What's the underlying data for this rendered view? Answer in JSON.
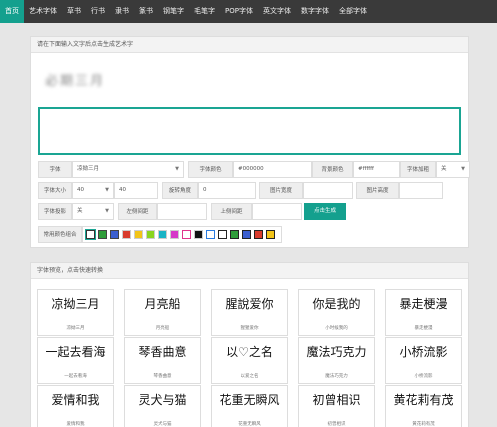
{
  "nav": {
    "items": [
      "首页",
      "艺术字体",
      "草书",
      "行书",
      "隶书",
      "篆书",
      "钢笔字",
      "毛笔字",
      "POP字体",
      "英文字体",
      "数字字体",
      "全部字体"
    ],
    "active_index": 0
  },
  "form_panel": {
    "title": "请在下面输入文字后点击生成艺术字",
    "preview_text": "必期三月",
    "textarea_placeholder": "",
    "font_label": "字体",
    "font_value": "凉拗三月",
    "font_color_label": "字体颜色",
    "font_color_value": "#000000",
    "bg_color_label": "背景颜色",
    "bg_color_value": "#ffffff",
    "bold_label": "字体加粗",
    "bold_value": "关",
    "size_label": "字体大小",
    "size_select_value": "40",
    "size_input_value": "40",
    "rotate_label": "旋转角度",
    "rotate_value": "0",
    "img_width_label": "图片宽度",
    "img_width_value": "",
    "img_height_label": "图片高度",
    "img_height_value": "",
    "shadow_label": "字体投影",
    "shadow_value": "关",
    "left_gap_label": "左侧间距",
    "left_gap_value": "",
    "top_gap_label": "上侧间距",
    "top_gap_value": "",
    "generate_label": "点击生成",
    "palette_label": "常用颜色组合",
    "palette": [
      {
        "fill": "#ffffff",
        "border": "#333333"
      },
      {
        "fill": "#2e9c3a",
        "border": "#444444"
      },
      {
        "fill": "#3b5fd0",
        "border": "#444444"
      },
      {
        "fill": "#d83b2d",
        "border": "#ffffff"
      },
      {
        "fill": "#f2c418",
        "border": "#ffffff"
      },
      {
        "fill": "#8ad41e",
        "border": "#ffffff"
      },
      {
        "fill": "#19b3c5",
        "border": "#ffffff"
      },
      {
        "fill": "#d638c8",
        "border": "#ffffff"
      },
      {
        "fill": "#ffffff",
        "border": "#e0338a"
      },
      {
        "fill": "#111111",
        "border": "#ffffff"
      },
      {
        "fill": "#ffffff",
        "border": "#2a7be0"
      },
      {
        "fill": "#ffffff",
        "border": "#222222"
      },
      {
        "fill": "#2e9c3a",
        "border": "#222222"
      },
      {
        "fill": "#3b5fd0",
        "border": "#222222"
      },
      {
        "fill": "#d83b2d",
        "border": "#222222"
      },
      {
        "fill": "#f2c418",
        "border": "#222222"
      }
    ]
  },
  "preview_panel": {
    "title": "字体预览，点击快速转换",
    "cards": [
      {
        "art": "凉拗三月",
        "name": "凉拗三月"
      },
      {
        "art": "月亮船",
        "name": "月亮船"
      },
      {
        "art": "腥說爱你",
        "name": "猩猩爱你"
      },
      {
        "art": "你是我的",
        "name": "小时候我的"
      },
      {
        "art": "暴走梗漫",
        "name": "暴走梗漫"
      },
      {
        "art": "一起去看海",
        "name": "一起去看海"
      },
      {
        "art": "琴香曲意",
        "name": "琴香曲意"
      },
      {
        "art": "以♡之名",
        "name": "以爱之名"
      },
      {
        "art": "魔法巧克力",
        "name": "魔法巧克力"
      },
      {
        "art": "小桥流影",
        "name": "小桥流影"
      },
      {
        "art": "爱情和我",
        "name": "爱情和我"
      },
      {
        "art": "灵犬与猫",
        "name": "灵犬与猫"
      },
      {
        "art": "花重无瞬风",
        "name": "花重无瞬风"
      },
      {
        "art": "初曾相识",
        "name": "初曾相识"
      },
      {
        "art": "黄花莉有茂",
        "name": "黄花莉有茂"
      }
    ]
  }
}
